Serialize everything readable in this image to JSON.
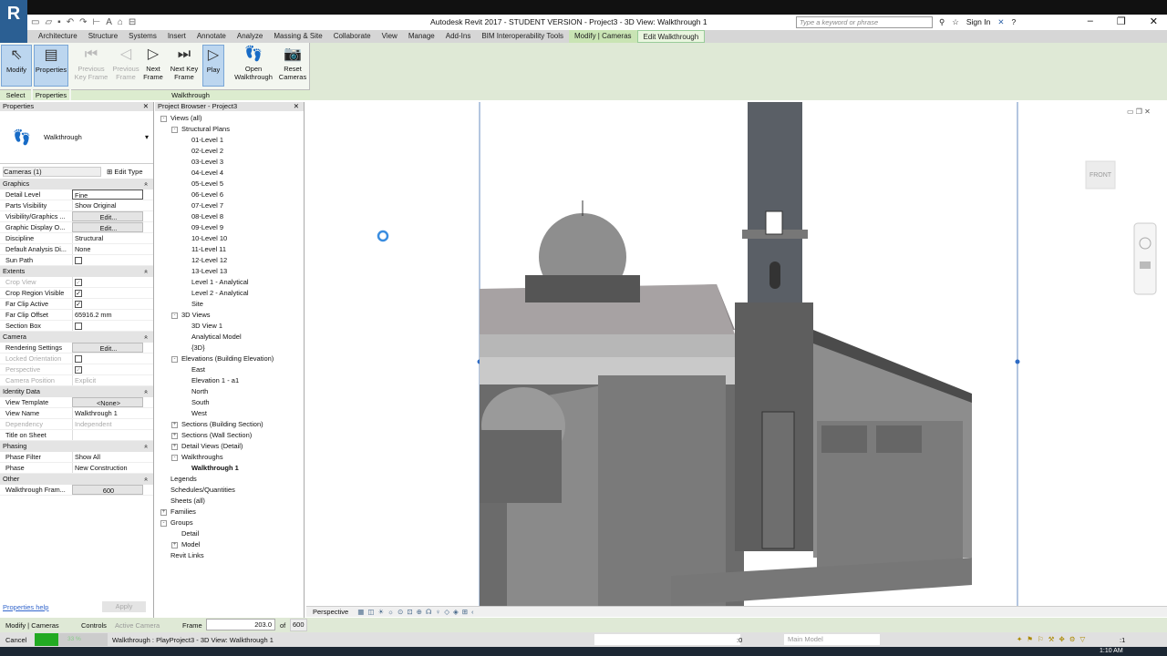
{
  "app": {
    "logo": "R",
    "title": "Autodesk Revit 2017 - STUDENT VERSION -   Project3 - 3D View: Walkthrough 1",
    "search_placeholder": "Type a keyword or phrase",
    "sign_in": "Sign In"
  },
  "tabs": [
    {
      "label": "Architecture"
    },
    {
      "label": "Structure"
    },
    {
      "label": "Systems"
    },
    {
      "label": "Insert"
    },
    {
      "label": "Annotate"
    },
    {
      "label": "Analyze"
    },
    {
      "label": "Massing & Site"
    },
    {
      "label": "Collaborate"
    },
    {
      "label": "View"
    },
    {
      "label": "Manage"
    },
    {
      "label": "Add-Ins"
    },
    {
      "label": "BIM Interoperability Tools"
    },
    {
      "label": "Modify | Cameras"
    },
    {
      "label": "Edit Walkthrough"
    }
  ],
  "ribbon": {
    "buttons": [
      {
        "label": "Modify",
        "icon": "cursor-icon",
        "state": "sel"
      },
      {
        "label": "Properties",
        "icon": "properties-icon",
        "state": "sel"
      },
      {
        "label": "Previous Key Frame",
        "icon": "prev-keyframe-icon",
        "state": "dis"
      },
      {
        "label": "Previous Frame",
        "icon": "prev-frame-icon",
        "state": "dis"
      },
      {
        "label": "Next Frame",
        "icon": "next-frame-icon",
        "state": ""
      },
      {
        "label": "Next Key Frame",
        "icon": "next-keyframe-icon",
        "state": ""
      },
      {
        "label": "Play",
        "icon": "play-icon",
        "state": "sel"
      },
      {
        "label": "Open Walkthrough",
        "icon": "footprints-icon",
        "state": ""
      },
      {
        "label": "Reset Cameras",
        "icon": "camera-icon",
        "state": ""
      }
    ],
    "panels": {
      "select": "Select",
      "properties": "Properties",
      "walkthrough": "Walkthrough"
    }
  },
  "properties": {
    "title": "Properties",
    "type_name": "Walkthrough",
    "selector": "Cameras (1)",
    "edit_type": "Edit Type",
    "help": "Properties help",
    "apply": "Apply",
    "sections": [
      {
        "name": "Graphics",
        "rows": [
          {
            "k": "Detail Level",
            "v": "Fine",
            "t": "inp"
          },
          {
            "k": "Parts Visibility",
            "v": "Show Original"
          },
          {
            "k": "Visibility/Graphics ...",
            "v": "Edit...",
            "t": "btn"
          },
          {
            "k": "Graphic Display O...",
            "v": "Edit...",
            "t": "btn"
          },
          {
            "k": "Discipline",
            "v": "Structural"
          },
          {
            "k": "Default Analysis Di...",
            "v": "None"
          },
          {
            "k": "Sun Path",
            "cb": false
          }
        ]
      },
      {
        "name": "Extents",
        "rows": [
          {
            "k": "Crop View",
            "cb": true,
            "dis": true
          },
          {
            "k": "Crop Region Visible",
            "cb": true
          },
          {
            "k": "Far Clip Active",
            "cb": true
          },
          {
            "k": "Far Clip Offset",
            "v": "65916.2 mm"
          },
          {
            "k": "Section Box",
            "cb": false
          }
        ]
      },
      {
        "name": "Camera",
        "rows": [
          {
            "k": "Rendering Settings",
            "v": "Edit...",
            "t": "btn"
          },
          {
            "k": "Locked Orientation",
            "cb": false,
            "dis": true
          },
          {
            "k": "Perspective",
            "cb": true,
            "dis": true
          },
          {
            "k": "Camera Position",
            "v": "Explicit",
            "dis": true
          }
        ]
      },
      {
        "name": "Identity Data",
        "rows": [
          {
            "k": "View Template",
            "v": "<None>",
            "t": "btn"
          },
          {
            "k": "View Name",
            "v": "Walkthrough 1"
          },
          {
            "k": "Dependency",
            "v": "Independent",
            "dis": true
          },
          {
            "k": "Title on Sheet",
            "v": ""
          }
        ]
      },
      {
        "name": "Phasing",
        "rows": [
          {
            "k": "Phase Filter",
            "v": "Show All"
          },
          {
            "k": "Phase",
            "v": "New Construction"
          }
        ]
      },
      {
        "name": "Other",
        "rows": [
          {
            "k": "Walkthrough Fram...",
            "v": "600",
            "t": "btn"
          }
        ]
      }
    ]
  },
  "browser": {
    "title": "Project Browser - Project3",
    "items": [
      {
        "l": "Views (all)",
        "d": 0,
        "pm": "-"
      },
      {
        "l": "Structural Plans",
        "d": 1,
        "pm": "-"
      },
      {
        "l": "01-Level 1",
        "d": 2
      },
      {
        "l": "02-Level 2",
        "d": 2
      },
      {
        "l": "03-Level 3",
        "d": 2
      },
      {
        "l": "04-Level 4",
        "d": 2
      },
      {
        "l": "05-Level 5",
        "d": 2
      },
      {
        "l": "06-Level 6",
        "d": 2
      },
      {
        "l": "07-Level 7",
        "d": 2
      },
      {
        "l": "08-Level 8",
        "d": 2
      },
      {
        "l": "09-Level 9",
        "d": 2
      },
      {
        "l": "10-Level 10",
        "d": 2
      },
      {
        "l": "11-Level 11",
        "d": 2
      },
      {
        "l": "12-Level 12",
        "d": 2
      },
      {
        "l": "13-Level 13",
        "d": 2
      },
      {
        "l": "Level 1 - Analytical",
        "d": 2
      },
      {
        "l": "Level 2 - Analytical",
        "d": 2
      },
      {
        "l": "Site",
        "d": 2
      },
      {
        "l": "3D Views",
        "d": 1,
        "pm": "-"
      },
      {
        "l": "3D View 1",
        "d": 2
      },
      {
        "l": "Analytical Model",
        "d": 2
      },
      {
        "l": "{3D}",
        "d": 2
      },
      {
        "l": "Elevations (Building Elevation)",
        "d": 1,
        "pm": "-"
      },
      {
        "l": "East",
        "d": 2
      },
      {
        "l": "Elevation 1 - a1",
        "d": 2
      },
      {
        "l": "North",
        "d": 2
      },
      {
        "l": "South",
        "d": 2
      },
      {
        "l": "West",
        "d": 2
      },
      {
        "l": "Sections (Building Section)",
        "d": 1,
        "pm": "+"
      },
      {
        "l": "Sections (Wall Section)",
        "d": 1,
        "pm": "+"
      },
      {
        "l": "Detail Views (Detail)",
        "d": 1,
        "pm": "+"
      },
      {
        "l": "Walkthroughs",
        "d": 1,
        "pm": "-"
      },
      {
        "l": "Walkthrough 1",
        "d": 2,
        "b": true
      },
      {
        "l": "Legends",
        "d": 0
      },
      {
        "l": "Schedules/Quantities",
        "d": 0
      },
      {
        "l": "Sheets (all)",
        "d": 0
      },
      {
        "l": "Families",
        "d": 0,
        "pm": "+"
      },
      {
        "l": "Groups",
        "d": 0,
        "pm": "-"
      },
      {
        "l": "Detail",
        "d": 1
      },
      {
        "l": "Model",
        "d": 1,
        "pm": "+"
      },
      {
        "l": "Revit Links",
        "d": 0
      }
    ]
  },
  "viewcube": {
    "face": "FRONT"
  },
  "viewbar": {
    "mode": "Perspective"
  },
  "options": {
    "context": "Modify | Cameras",
    "controls": "Controls",
    "controls_value": "Active Camera",
    "frame_label": "Frame",
    "frame_value": "203.0",
    "of": "of",
    "total": "600"
  },
  "status": {
    "cancel": "Cancel",
    "progress_pct": 33,
    "progress_text": "33 %",
    "message": "Walkthrough : PlayProject3 - 3D View: Walkthrough 1",
    "workset_count": ":0",
    "model": "Main Model",
    "filter": ":1"
  },
  "taskbar": {
    "time": "1:10 AM"
  },
  "colors": {
    "ribbon_ctx": "#c9e4b4",
    "progress": "#22aa22",
    "selection": "#bcd6ef"
  }
}
